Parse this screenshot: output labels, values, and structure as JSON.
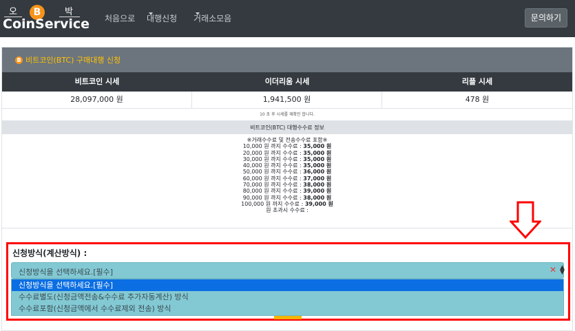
{
  "navbar": {
    "logo_top_left": "오",
    "logo_coin": "B",
    "logo_top_right": "박",
    "logo_name": "CoinService",
    "links": [
      {
        "label": "처음으로",
        "caret": false
      },
      {
        "label": "대행신청",
        "caret": true
      },
      {
        "label": "거래소모음",
        "caret": true
      }
    ],
    "inquiry_label": "문의하기"
  },
  "card": {
    "icon_letter": "B",
    "title": "비트코인(BTC) 구매대행 신청",
    "price_headers": [
      "비트코인 시세",
      "이더리움 시세",
      "리플 시세"
    ],
    "prices": [
      "28,097,000 원",
      "1,941,500 원",
      "478 원"
    ],
    "refresh_note": "10 초 후 시세를 재확인 합니다.",
    "fee_title": "비트코인(BTC) 대행수수료 정보",
    "fee_note": "※거래수수료 및 전송수수료 포함※",
    "fees": [
      {
        "limit": "10,000 원 까지 수수료 :",
        "fee": "35,000 원"
      },
      {
        "limit": "20,000 원 까지 수수료 :",
        "fee": "35,000 원"
      },
      {
        "limit": "30,000 원 까지 수수료 :",
        "fee": "35,000 원"
      },
      {
        "limit": "40,000 원 까지 수수료 :",
        "fee": "35,000 원"
      },
      {
        "limit": "50,000 원 까지 수수료 :",
        "fee": "36,000 원"
      },
      {
        "limit": "60,000 원 까지 수수료 :",
        "fee": "37,000 원"
      },
      {
        "limit": "70,000 원 까지 수수료 :",
        "fee": "38,000 원"
      },
      {
        "limit": "80,000 원 까지 수수료 :",
        "fee": "39,000 원"
      },
      {
        "limit": "90,000 원 까지 수수료 :",
        "fee": "38,000 원"
      },
      {
        "limit": "100,000 원 까지 수수료 :",
        "fee": "39,000 원"
      }
    ],
    "fee_over": "원 초과시 수수료 :"
  },
  "method": {
    "label": "신청방식(계산방식) :",
    "selected": "신청방식을 선택하세요.[필수]",
    "clear_glyph": "✕",
    "options": [
      "신청방식을 선택하세요.[필수]",
      "수수료별도(신청금액전송&수수료 추가자동계산) 방식",
      "수수료포함(신청금액에서 수수료제외 전송) 방식"
    ]
  },
  "colors": {
    "navbar": "#343a40",
    "header": "#6c757d",
    "accent": "#ffc107",
    "bitcoin": "#f7931a",
    "highlight": "#ff0000",
    "select_bg": "#83c9d4",
    "option_selected": "#0b6ee3"
  }
}
